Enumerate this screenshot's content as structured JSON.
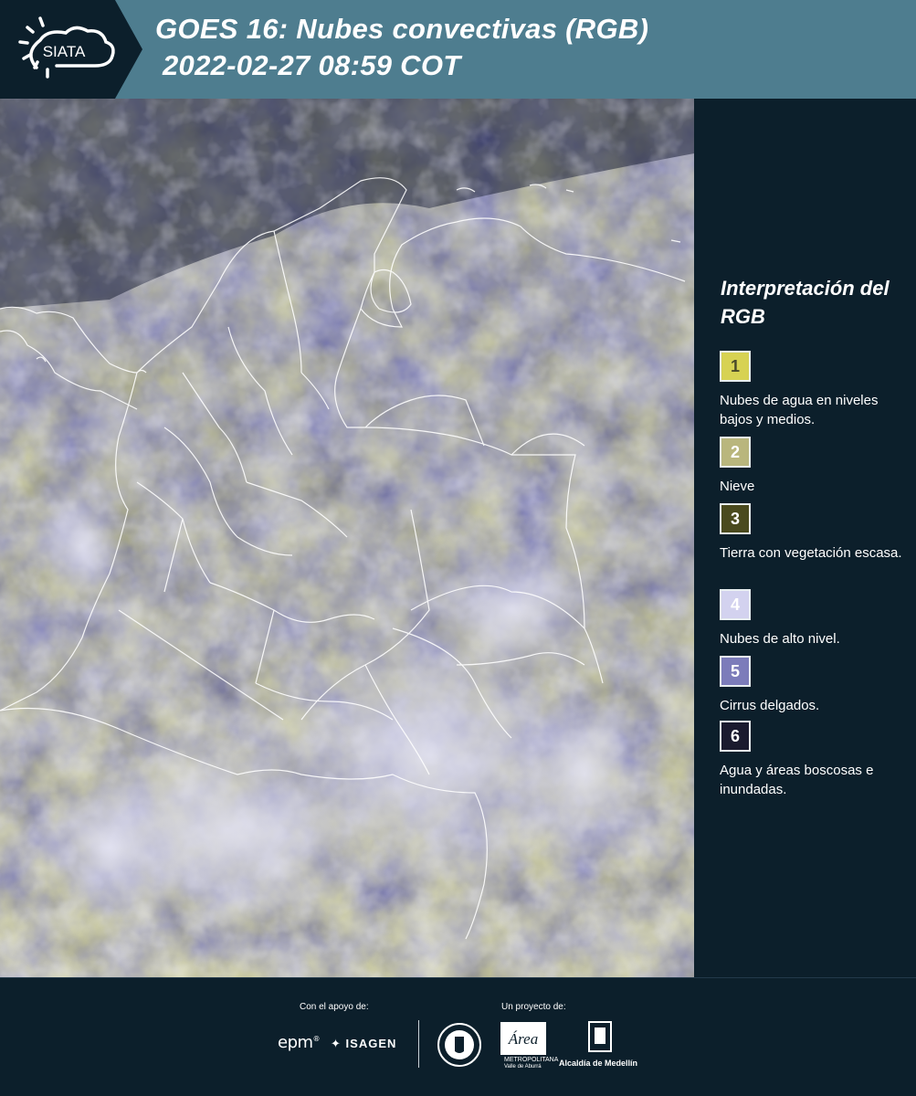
{
  "header": {
    "logo_text": "SIATA",
    "title_line1": "GOES 16: Nubes convectivas (RGB)",
    "title_line2": "2022-02-27 08:59 COT"
  },
  "legend": {
    "title": "Interpretación del RGB",
    "items": [
      {
        "number": "1",
        "color": "#d7d253",
        "text_color": "#4a4a2a",
        "description": "Nubes de agua en niveles bajos y medios."
      },
      {
        "number": "2",
        "color": "#b9b67d",
        "text_color": "#ffffff",
        "description": "Nieve"
      },
      {
        "number": "3",
        "color": "#4a4a1e",
        "text_color": "#ffffff",
        "description": "Tierra con vegetación escasa."
      },
      {
        "number": "4",
        "color": "#d3d2ef",
        "text_color": "#ffffff",
        "description": "Nubes de alto nivel."
      },
      {
        "number": "5",
        "color": "#7c7cba",
        "text_color": "#ffffff",
        "description": "Cirrus delgados."
      },
      {
        "number": "6",
        "color": "#1a1a2e",
        "text_color": "#ffffff",
        "description": "Agua y áreas boscosas e inundadas."
      }
    ]
  },
  "footer": {
    "support_label": "Con el apoyo de:",
    "project_label": "Un proyecto de:",
    "epm": "epm",
    "isagen": "ISAGEN",
    "area_text": "Área",
    "area_subtext": "METROPOLITANA",
    "area_subtext2": "Valle de Aburrá",
    "alcaldia": "Alcaldía de Medellín"
  },
  "colors": {
    "header_bg": "#4e7d8f",
    "logo_bg": "#0c1f2b",
    "panel_bg": "#0c1f2b"
  }
}
